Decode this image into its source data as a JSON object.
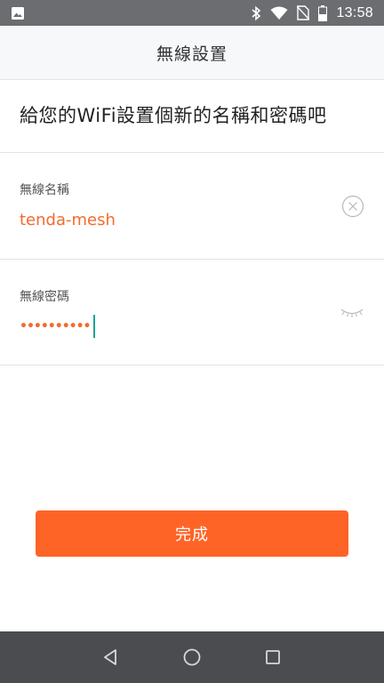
{
  "status_bar": {
    "time": "13:58",
    "icons": [
      "image-icon",
      "bluetooth-icon",
      "wifi-icon",
      "no-sim-icon",
      "battery-icon"
    ]
  },
  "header": {
    "title": "無線設置"
  },
  "prompt": {
    "text": "給您的WiFi設置個新的名稱和密碼吧"
  },
  "wifi_name": {
    "label": "無線名稱",
    "value": "tenda-mesh",
    "clear_icon": "clear-circle-icon"
  },
  "wifi_password": {
    "label": "無線密碼",
    "masked_value": "••••••••••",
    "toggle_icon": "eye-closed-icon"
  },
  "submit": {
    "label": "完成"
  },
  "nav_bar": {
    "icons": [
      "back-triangle-icon",
      "home-circle-icon",
      "recents-square-icon"
    ]
  },
  "colors": {
    "accent": "#ff6427",
    "value_text": "#f26b2e",
    "caret": "#1aa393",
    "status_bar": "#6b6d70",
    "nav_bar": "#4a4c4f"
  }
}
